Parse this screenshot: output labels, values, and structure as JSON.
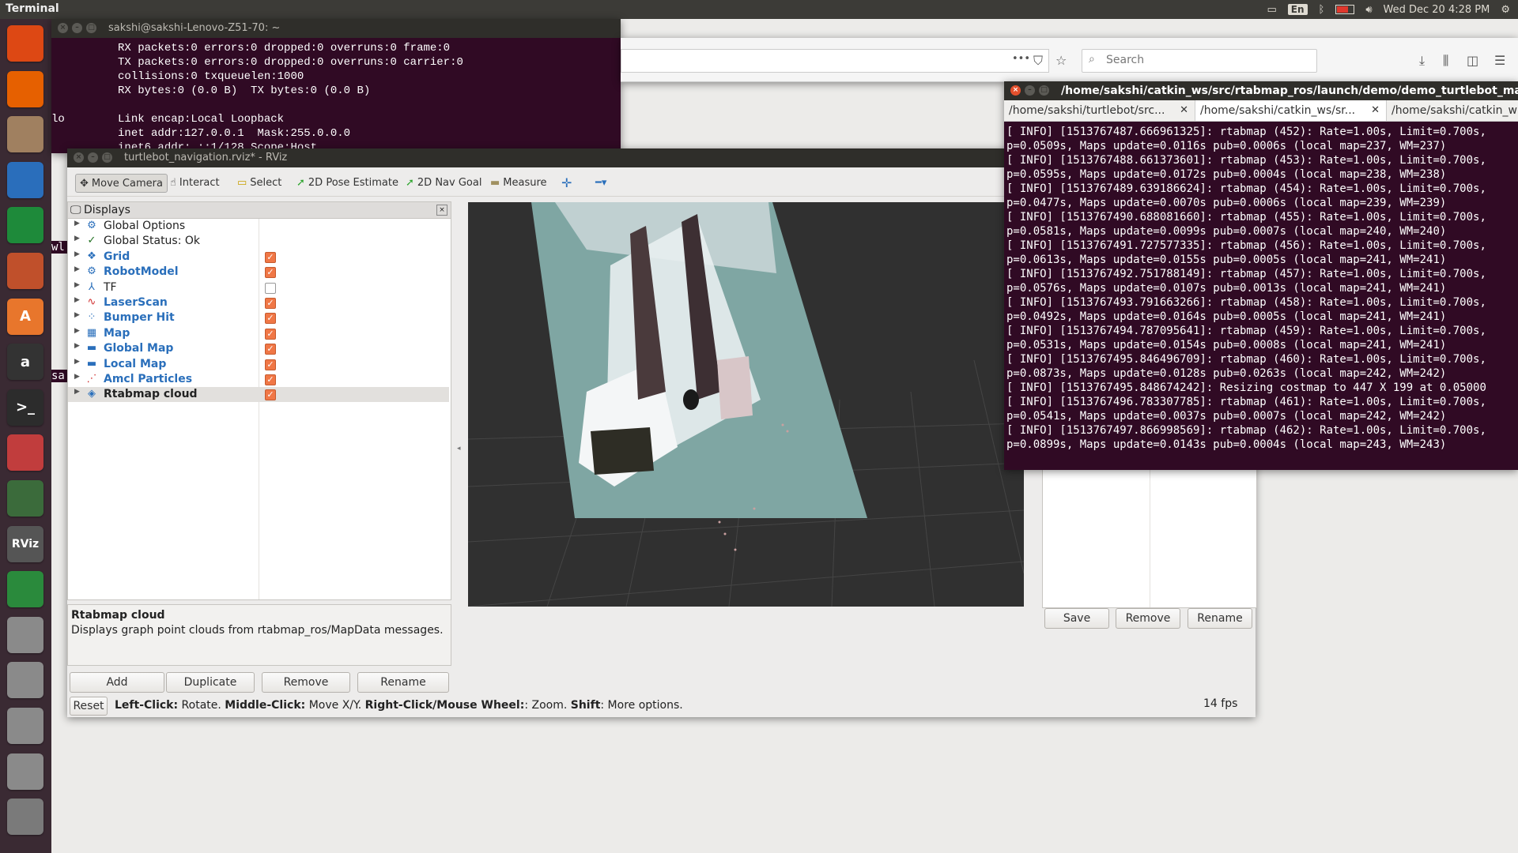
{
  "top_panel": {
    "app_name": "Terminal",
    "keyboard_layout": "En",
    "datetime": "Wed Dec 20  4:28 PM"
  },
  "launcher": {
    "items": [
      {
        "name": "ubuntu-dash",
        "label": "",
        "color": "#dd4814"
      },
      {
        "name": "firefox",
        "label": "",
        "color": "#e66000"
      },
      {
        "name": "files",
        "label": "",
        "color": "#a08060"
      },
      {
        "name": "writer",
        "label": "",
        "color": "#2a6ebb"
      },
      {
        "name": "calc",
        "label": "",
        "color": "#1e8a3a"
      },
      {
        "name": "impress",
        "label": "",
        "color": "#c0502b"
      },
      {
        "name": "software-center",
        "label": "A",
        "color": "#e8762c"
      },
      {
        "name": "amazon",
        "label": "a",
        "color": "#333333"
      },
      {
        "name": "terminal",
        "label": ">_",
        "color": "#2c2c2c"
      },
      {
        "name": "system-settings",
        "label": "",
        "color": "#c13d3d"
      },
      {
        "name": "software-updater",
        "label": "",
        "color": "#3b6b3b"
      },
      {
        "name": "rviz",
        "label": "RViz",
        "color": "#555555"
      },
      {
        "name": "chrome",
        "label": "",
        "color": "#2a8a3c"
      },
      {
        "name": "drive-1",
        "label": "",
        "color": "#8a8a8a"
      },
      {
        "name": "drive-2",
        "label": "",
        "color": "#8a8a8a"
      },
      {
        "name": "drive-3",
        "label": "",
        "color": "#8a8a8a"
      },
      {
        "name": "drive-4",
        "label": "",
        "color": "#8a8a8a"
      },
      {
        "name": "trash",
        "label": "",
        "color": "#7a7a7a"
      }
    ]
  },
  "term_back": {
    "title": "sakshi@sakshi-Lenovo-Z51-70: ~",
    "lines": [
      "          RX packets:0 errors:0 dropped:0 overruns:0 frame:0",
      "          TX packets:0 errors:0 dropped:0 overruns:0 carrier:0",
      "          collisions:0 txqueuelen:1000",
      "          RX bytes:0 (0.0 B)  TX bytes:0 (0.0 B)",
      "",
      "lo        Link encap:Local Loopback",
      "          inet addr:127.0.0.1  Mask:255.0.0.0",
      "          inet6 addr: ::1/128 Scope:Host"
    ],
    "fragments": [
      "wl",
      "sa"
    ]
  },
  "firefox": {
    "search_placeholder": "Search",
    "more_icon": "•••"
  },
  "rviz": {
    "title": "turtlebot_navigation.rviz* - RViz",
    "tools": [
      {
        "label": "Move Camera",
        "icon": "✥",
        "active": true
      },
      {
        "label": "Interact",
        "icon": "☝",
        "active": false
      },
      {
        "label": "Select",
        "icon": "▭",
        "active": false
      },
      {
        "label": "2D Pose Estimate",
        "icon": "➚",
        "active": false
      },
      {
        "label": "2D Nav Goal",
        "icon": "➚",
        "active": false
      },
      {
        "label": "Measure",
        "icon": "▬",
        "active": false
      }
    ],
    "displays_title": "Displays",
    "displays": [
      {
        "label": "Global Options",
        "style": "plain",
        "icon": "⚙",
        "checkbox": null
      },
      {
        "label": "Global Status: Ok",
        "style": "plain",
        "icon": "✓",
        "checkbox": null
      },
      {
        "label": "Grid",
        "style": "blue",
        "icon": "❖",
        "checkbox": true
      },
      {
        "label": "RobotModel",
        "style": "blue",
        "icon": "⚙",
        "checkbox": true
      },
      {
        "label": "TF",
        "style": "plain",
        "icon": "⅄",
        "checkbox": false
      },
      {
        "label": "LaserScan",
        "style": "blue",
        "icon": "∿",
        "checkbox": true
      },
      {
        "label": "Bumper Hit",
        "style": "blue",
        "icon": "⁘",
        "checkbox": true
      },
      {
        "label": "Map",
        "style": "blue",
        "icon": "▦",
        "checkbox": true
      },
      {
        "label": "Global Map",
        "style": "blue",
        "icon": "▬",
        "checkbox": true
      },
      {
        "label": "Local Map",
        "style": "blue",
        "icon": "▬",
        "checkbox": true
      },
      {
        "label": "Amcl Particles",
        "style": "blue",
        "icon": "⋰",
        "checkbox": true
      },
      {
        "label": "Rtabmap cloud",
        "style": "bold",
        "icon": "◈",
        "checkbox": true
      }
    ],
    "description_title": "Rtabmap cloud",
    "description_text": "Displays graph point clouds from rtabmap_ros/MapData messages.",
    "buttons": {
      "add": "Add",
      "duplicate": "Duplicate",
      "remove": "Remove",
      "rename": "Rename"
    },
    "right_buttons": {
      "save": "Save",
      "remove": "Remove",
      "rename": "Rename"
    },
    "status": {
      "reset": "Reset",
      "left_click_key": "Left-Click:",
      "left_click_val": " Rotate. ",
      "middle_click_key": "Middle-Click:",
      "middle_click_val": " Move X/Y. ",
      "right_click_key": "Right-Click/Mouse Wheel:",
      "right_click_val": ": Zoom. ",
      "shift_key": "Shift",
      "shift_val": ": More options.",
      "fps": "14 fps"
    }
  },
  "term_front": {
    "title": "/home/sakshi/catkin_ws/src/rtabmap_ros/launch/demo/demo_turtlebot_mapping",
    "tabs": [
      {
        "label": "/home/sakshi/turtlebot/src...",
        "close": "✕"
      },
      {
        "label": "/home/sakshi/catkin_ws/sr...",
        "close": "✕"
      },
      {
        "label": "/home/sakshi/catkin_w",
        "close": ""
      }
    ],
    "lines": [
      "[ INFO] [1513767487.666961325]: rtabmap (452): Rate=1.00s, Limit=0.700s,",
      "p=0.0509s, Maps update=0.0116s pub=0.0006s (local map=237, WM=237)",
      "[ INFO] [1513767488.661373601]: rtabmap (453): Rate=1.00s, Limit=0.700s,",
      "p=0.0595s, Maps update=0.0172s pub=0.0004s (local map=238, WM=238)",
      "[ INFO] [1513767489.639186624]: rtabmap (454): Rate=1.00s, Limit=0.700s,",
      "p=0.0477s, Maps update=0.0070s pub=0.0006s (local map=239, WM=239)",
      "[ INFO] [1513767490.688081660]: rtabmap (455): Rate=1.00s, Limit=0.700s,",
      "p=0.0581s, Maps update=0.0099s pub=0.0007s (local map=240, WM=240)",
      "[ INFO] [1513767491.727577335]: rtabmap (456): Rate=1.00s, Limit=0.700s,",
      "p=0.0613s, Maps update=0.0155s pub=0.0005s (local map=241, WM=241)",
      "[ INFO] [1513767492.751788149]: rtabmap (457): Rate=1.00s, Limit=0.700s,",
      "p=0.0576s, Maps update=0.0107s pub=0.0013s (local map=241, WM=241)",
      "[ INFO] [1513767493.791663266]: rtabmap (458): Rate=1.00s, Limit=0.700s,",
      "p=0.0492s, Maps update=0.0164s pub=0.0005s (local map=241, WM=241)",
      "[ INFO] [1513767494.787095641]: rtabmap (459): Rate=1.00s, Limit=0.700s,",
      "p=0.0531s, Maps update=0.0154s pub=0.0008s (local map=241, WM=241)",
      "[ INFO] [1513767495.846496709]: rtabmap (460): Rate=1.00s, Limit=0.700s,",
      "p=0.0873s, Maps update=0.0128s pub=0.0263s (local map=242, WM=242)",
      "[ INFO] [1513767495.848674242]: Resizing costmap to 447 X 199 at 0.05000",
      "[ INFO] [1513767496.783307785]: rtabmap (461): Rate=1.00s, Limit=0.700s,",
      "p=0.0541s, Maps update=0.0037s pub=0.0007s (local map=242, WM=242)",
      "[ INFO] [1513767497.866998569]: rtabmap (462): Rate=1.00s, Limit=0.700s,",
      "p=0.0899s, Maps update=0.0143s pub=0.0004s (local map=243, WM=243)"
    ]
  }
}
